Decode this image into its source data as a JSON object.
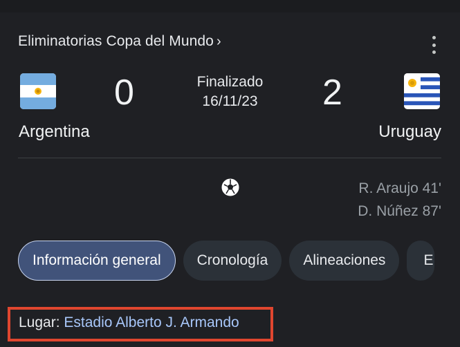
{
  "match": {
    "competition": "Eliminatorias Copa del Mundo",
    "status": "Finalizado",
    "date": "16/11/23",
    "home": {
      "name": "Argentina",
      "score": "0",
      "flag_icon": "argentina-flag-icon"
    },
    "away": {
      "name": "Uruguay",
      "score": "2",
      "flag_icon": "uruguay-flag-icon"
    },
    "goal_icon": "soccer-ball-icon",
    "scorers": [
      "R. Araujo 41'",
      "D. Núñez 87'"
    ]
  },
  "tabs": [
    {
      "label": "Información general",
      "active": true
    },
    {
      "label": "Cronología",
      "active": false
    },
    {
      "label": "Alineaciones",
      "active": false
    },
    {
      "label": "E",
      "active": false
    }
  ],
  "venue": {
    "label": "Lugar:",
    "value": "Estadio Alberto J. Armando"
  },
  "colors": {
    "background": "#1f2024",
    "active_chip": "#41537a",
    "chip": "#2b3138",
    "link": "#a8c7fa",
    "highlight": "#e0462f"
  }
}
